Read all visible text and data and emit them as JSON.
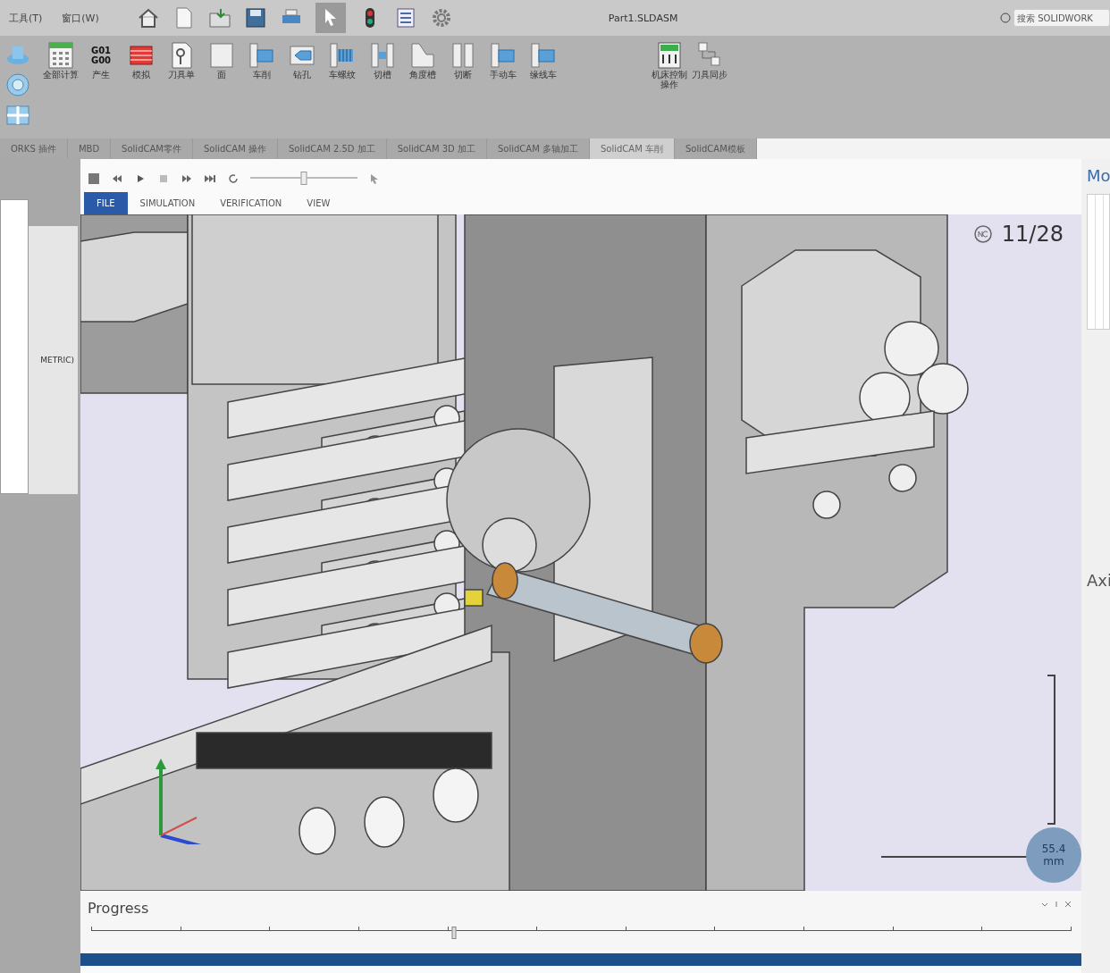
{
  "menu": [
    {
      "label": "工具(T)"
    },
    {
      "label": "窗口(W)"
    }
  ],
  "document_title": "Part1.SLDASM",
  "search": {
    "placeholder": "搜索 SOLIDWORK"
  },
  "ribbon": {
    "commands": [
      {
        "label": "全部计算",
        "kind": "grid"
      },
      {
        "label": "产生",
        "kind": "gcode",
        "icon_text": "G01 G00"
      },
      {
        "label": "模拟",
        "kind": "stack"
      },
      {
        "label": "刀具单",
        "kind": "sheet"
      },
      {
        "label": "面",
        "kind": "block"
      },
      {
        "label": "车削",
        "kind": "turn"
      },
      {
        "label": "钻孔",
        "kind": "drill"
      },
      {
        "label": "车螺纹",
        "kind": "thread"
      },
      {
        "label": "切槽",
        "kind": "groove"
      },
      {
        "label": "角度槽",
        "kind": "angle"
      },
      {
        "label": "切断",
        "kind": "cut"
      },
      {
        "label": "手动车",
        "kind": "turn"
      },
      {
        "label": "缘线车",
        "kind": "turn"
      },
      {
        "label": "机床控制操作",
        "kind": "machine"
      },
      {
        "label": "刀具同步",
        "kind": "sync"
      }
    ]
  },
  "addin_tabs": [
    {
      "label": "ORKS 插件",
      "selected": false
    },
    {
      "label": "MBD",
      "selected": false
    },
    {
      "label": "SolidCAM零件",
      "selected": false
    },
    {
      "label": "SolidCAM 操作",
      "selected": false
    },
    {
      "label": "SolidCAM 2.5D 加工",
      "selected": false
    },
    {
      "label": "SolidCAM 3D 加工",
      "selected": false
    },
    {
      "label": "SolidCAM 多轴加工",
      "selected": false
    },
    {
      "label": "SolidCAM 车削",
      "selected": true
    },
    {
      "label": "SolidCAM模板",
      "selected": false
    }
  ],
  "left_panel": {
    "text": "METRIC)"
  },
  "simulation": {
    "speed": {
      "level": 0.5
    },
    "tabs": [
      {
        "label": "FILE",
        "selected": true
      },
      {
        "label": "SIMULATION",
        "selected": false
      },
      {
        "label": "VERIFICATION",
        "selected": false
      },
      {
        "label": "VIEW",
        "selected": false
      }
    ],
    "counter": "11/28",
    "scale": {
      "value": "55.4",
      "unit": "mm"
    },
    "progress": {
      "title": "Progress",
      "level": 0.37
    }
  },
  "right_panel": {
    "heading_1": "Mo",
    "heading_2": "Axi"
  }
}
